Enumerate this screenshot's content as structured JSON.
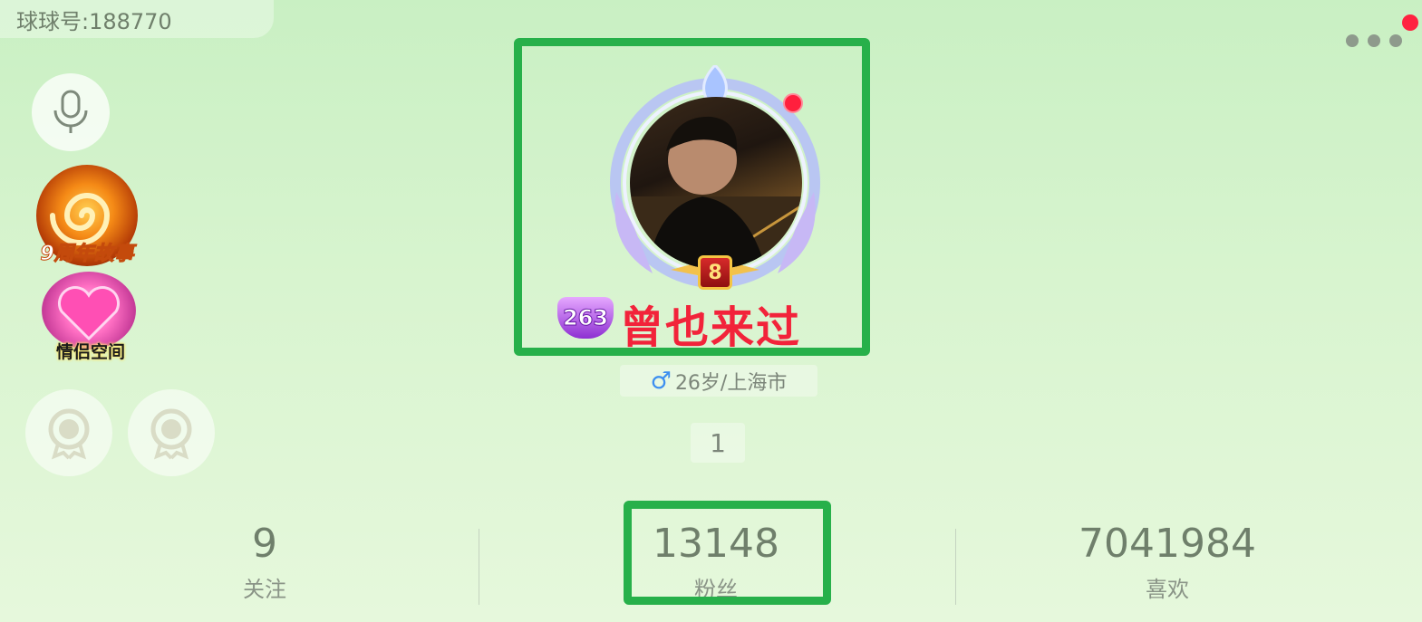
{
  "header": {
    "id_label": "球球号:188770",
    "more_icon": "more-dots-icon",
    "notification_color": "#ff2340"
  },
  "sidebar": {
    "mic_icon": "microphone-icon",
    "anniversary_label": "9周年故事",
    "couple_space_label": "情侣空间",
    "medals": [
      "medal-icon",
      "medal-icon"
    ]
  },
  "profile": {
    "level": "8",
    "gem_level": "263",
    "nickname": "曾也来过",
    "gender_icon": "male-icon",
    "info": "26岁/上海市",
    "count": "1"
  },
  "stats": [
    {
      "value": "9",
      "label": "关注"
    },
    {
      "value": "13148",
      "label": "粉丝"
    },
    {
      "value": "7041984",
      "label": "喜欢"
    }
  ],
  "colors": {
    "highlight": "#27b04a",
    "nickname": "#f2233a",
    "gender": "#3d8ff0"
  }
}
